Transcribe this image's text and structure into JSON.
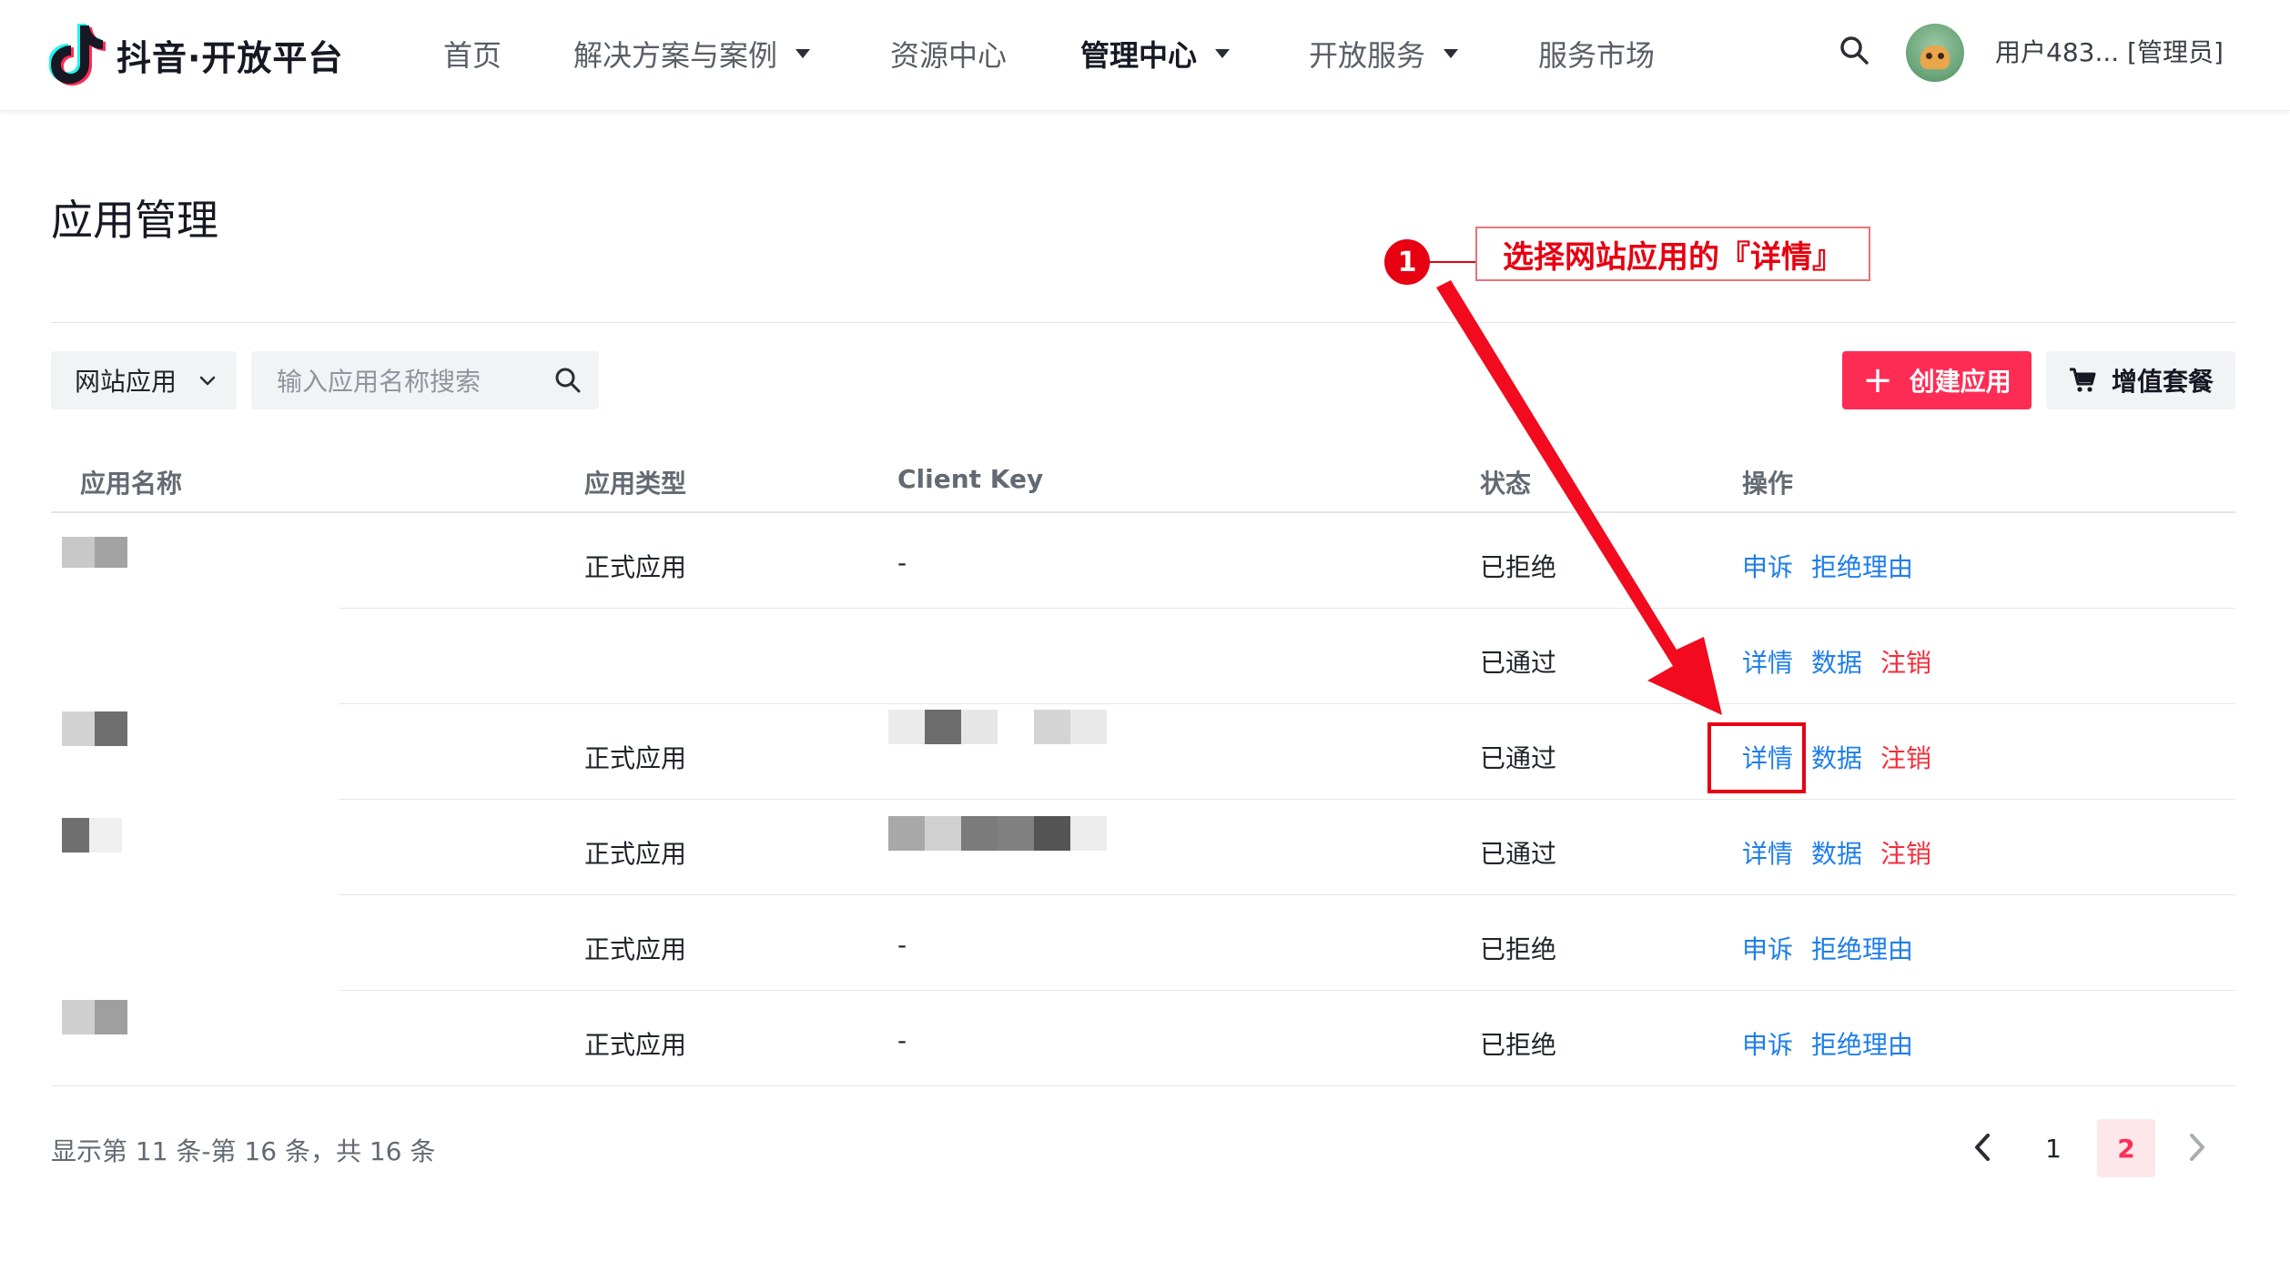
{
  "header": {
    "brand": "抖音·开放平台",
    "nav": [
      {
        "label": "首页",
        "dropdown": false,
        "active": false
      },
      {
        "label": "解决方案与案例",
        "dropdown": true,
        "active": false
      },
      {
        "label": "资源中心",
        "dropdown": false,
        "active": false
      },
      {
        "label": "管理中心",
        "dropdown": true,
        "active": true
      },
      {
        "label": "开放服务",
        "dropdown": true,
        "active": false
      },
      {
        "label": "服务市场",
        "dropdown": false,
        "active": false
      }
    ],
    "search_icon": "search-icon",
    "user": "用户483... [管理员]"
  },
  "page": {
    "title": "应用管理"
  },
  "toolbar": {
    "filter_value": "网站应用",
    "search_placeholder": "输入应用名称搜索",
    "create_label": "创建应用",
    "plan_label": "增值套餐"
  },
  "table": {
    "columns": [
      "应用名称",
      "应用类型",
      "Client Key",
      "状态",
      "操作"
    ],
    "rows": [
      {
        "type": "正式应用",
        "client_key": "-",
        "status": "已拒绝",
        "actions": [
          "申诉",
          "拒绝理由"
        ]
      },
      {
        "type": "",
        "client_key": "",
        "status": "已通过",
        "actions": [
          "详情",
          "数据",
          "注销"
        ]
      },
      {
        "type": "正式应用",
        "client_key": "",
        "status": "已通过",
        "actions": [
          "详情",
          "数据",
          "注销"
        ]
      },
      {
        "type": "正式应用",
        "client_key": "",
        "status": "已通过",
        "actions": [
          "详情",
          "数据",
          "注销"
        ]
      },
      {
        "type": "正式应用",
        "client_key": "-",
        "status": "已拒绝",
        "actions": [
          "申诉",
          "拒绝理由"
        ]
      },
      {
        "type": "正式应用",
        "client_key": "-",
        "status": "已拒绝",
        "actions": [
          "申诉",
          "拒绝理由"
        ]
      }
    ]
  },
  "footer": {
    "summary": "显示第 11 条-第 16 条，共 16 条",
    "pages": [
      "1",
      "2"
    ],
    "current_page": "2"
  },
  "annotation": {
    "step": "1",
    "text": "选择网站应用的『详情』"
  },
  "colors": {
    "brand_red": "#fe2c55",
    "link_blue": "#1e7ee8",
    "danger_red": "#f22e3b",
    "annotation_red": "#e60012"
  }
}
